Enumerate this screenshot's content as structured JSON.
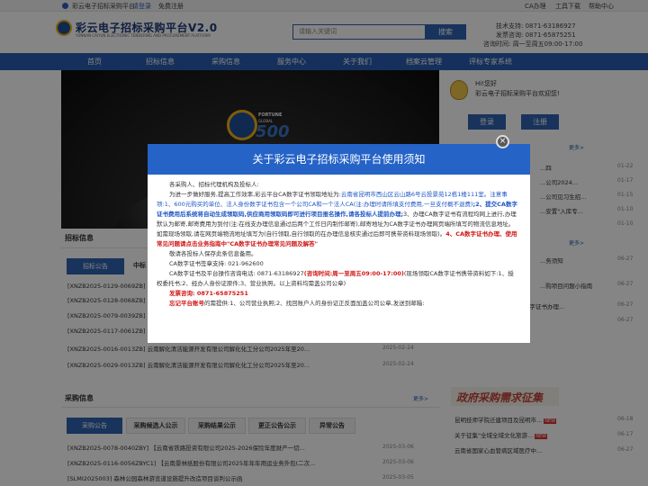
{
  "topbar": {
    "site_name": "彩云电子招标采购平台",
    "login_link": "请登录",
    "register_link": "免费注册",
    "ca_link": "CA办理",
    "tools_link": "工具下载",
    "help_link": "帮助中心"
  },
  "header": {
    "logo_text": "彩云电子招标采购平台V2.0",
    "logo_sub": "YUNNAN CAIYUN ELECTRONIC TENDERING AND PROCUREMENT PLATFORM",
    "search_placeholder": "请输入关键词",
    "search_button": "搜索",
    "tech_support": "技术支持: 0871-63186927",
    "invoice_support": "发票咨询: 0871-65875251",
    "hours": "咨询时间: 周一至周五09:00-17:00"
  },
  "nav": {
    "items": [
      "首页",
      "招标信息",
      "采购信息",
      "服务中心",
      "关于我们",
      "档案云管理",
      "评标专家系统"
    ]
  },
  "banner": {
    "fortune": "FORTUNE",
    "global": "GLOBAL",
    "number": "500"
  },
  "user_panel": {
    "hi": "Hi!您好",
    "welcome": "彩云电子招标采购平台欢迎您!",
    "login": "登录",
    "register": "注册"
  },
  "right_news": {
    "more1": "更多>",
    "items": [
      {
        "text": "...四",
        "date": "01-22"
      },
      {
        "text": "...公司2024...",
        "date": "01-17"
      },
      {
        "text": "...公司见习生招...",
        "date": "01-15"
      },
      {
        "text": "...安置\"入库专...",
        "date": "01-10"
      },
      {
        "text": "...",
        "date": "01-10"
      }
    ],
    "more2": "更多>",
    "items2": [
      {
        "text": "...务须知",
        "date": "06-27"
      },
      {
        "text": "...购项目问题小指南",
        "date": "06-27"
      },
      {
        "text": "CA数字证书办理...",
        "date": "06-27"
      },
      {
        "text": "...",
        "date": "06-27"
      }
    ]
  },
  "zhaobiao": {
    "title": "招标信息",
    "tab_active": "招标公告",
    "tab2": "中标",
    "rows": [
      {
        "text": "[XNZB2025-0129-0069ZB]",
        "date": ""
      },
      {
        "text": "[XNZB2025-0128-0068ZB]",
        "date": ""
      },
      {
        "text": "[XNZB2025-0079-0039ZB]",
        "date": ""
      },
      {
        "text": "[XNZB2025-0117-0061ZB]",
        "date": ""
      },
      {
        "text": "[XNZB2025-0016-0013ZB] 云南解化清洁能源开发有限公司解化化工分公司2025年至20...",
        "date": "2025-02-24"
      },
      {
        "text": "[XNZB2025-0029-0013ZB] 云南解化清洁能源开发有限公司解化化工分公司2025年至20...",
        "date": "2025-02-24"
      }
    ]
  },
  "caigou": {
    "title": "采购信息",
    "tabs": [
      "采购公告",
      "采购候选人公示",
      "采购结果公示",
      "更正公告公示",
      "异常公告"
    ],
    "more": "更多>",
    "rows": [
      {
        "text": "[XNZB2025-0078-0040ZBY] 【云南省铁路投资有限公司2025-2026保险年度财产一切...",
        "date": "2025-03-06"
      },
      {
        "text": "[XNZB2025-0116-0056ZBYC1] 【云南景林纸股份有限公司2025年年年用运业务外包(二次...",
        "date": "2025-03-06"
      },
      {
        "text": "[SLMI2025003] 森林公园森林游览道设施提升改造项目谈判公示函",
        "date": "2025-03-05"
      }
    ]
  },
  "xuqiu": {
    "banner": "政府采购需求征集",
    "items": [
      {
        "text": "昆明技师学院迁建项目及昆明市...",
        "date": "06-18"
      },
      {
        "text": "关于征集\"全域全域文化旅游...",
        "date": "06-17"
      },
      {
        "text": "云南省国家心血管病区域医疗中...",
        "date": "06-27"
      }
    ],
    "new": "NEW"
  },
  "modal": {
    "title": "关于彩云电子招标采购平台使用须知",
    "close": "×",
    "p1": "各采购人、招标代理机构及投标人:",
    "p2_a": "为进一步做好服务,提高工作效率,彩云平台CA数字证书领取地址为:",
    "p2_b": "云南省昆明市西山区云山路6号云投景苑12栋1楼111室。注意事项:1、600元购买的单位、法人身份数字证书包含一个公司CA和一个法人CA(注:办理时请所填支付费用,一旦支付概不退费)",
    "p2_c": ";2、提交CA数字证书费用后系统将自动生成领取码,供应商用领取码即可进行项目报名操作,请各投标人提前办理;",
    "p2_d": "3、办理CA数字证书有流程均网上进行,办理默认为邮寄,邮寄费用为到付(注:在线支办理信息通过后两个工作日内制作邮寄),邮寄地址为CA数字证书办理网页端所填写的物流信息地址。如需现场领取,请在网页端物流地址填写为(自行领取,自行领取的在办理信息核实通过后即可携带资料现场领取)。",
    "p2_e": "4、CA数字证书办理、使用常见问题请点击业务指南中\"CA数字证书办理常见问题及解答\"",
    "p3": "敬请各投标人保存此条信息备用。",
    "p4": "CA数字证书签章支持: 021-962600",
    "p5_a": "CA数字证书及平台操作咨询电话: 0871-63186927",
    "p5_b": "(咨询时间:周一至周五09:00-17:00)",
    "p5_c": "(现场领取CA数字证书携带资料如下:1、授权委托书;2、经办人身份证原件;3、营业执照。以上资料均需盖公司公章)",
    "p6_label": "发票咨询: ",
    "p6_value": "0871-65875251",
    "p7_a": "忘记平台账号",
    "p7_b": "的需提供:1、公司营业执照;2、找回账户人的身份证正反面加盖公司公章,发送到邮箱:"
  }
}
